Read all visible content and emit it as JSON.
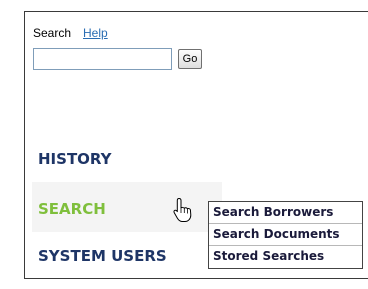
{
  "search": {
    "label": "Search",
    "help_link": "Help",
    "input_value": "",
    "input_placeholder": "",
    "go_label": "Go"
  },
  "nav": {
    "items": [
      {
        "label": "HISTORY",
        "color": "#1e3566"
      },
      {
        "label": "SEARCH",
        "color": "#7fbf3c",
        "active": true
      },
      {
        "label": "SYSTEM USERS",
        "color": "#1e3566"
      }
    ]
  },
  "submenu": {
    "items": [
      {
        "label": "Search Borrowers"
      },
      {
        "label": "Search Documents"
      },
      {
        "label": "Stored Searches"
      }
    ]
  },
  "icons": {
    "cursor": "hand-pointer-icon"
  }
}
